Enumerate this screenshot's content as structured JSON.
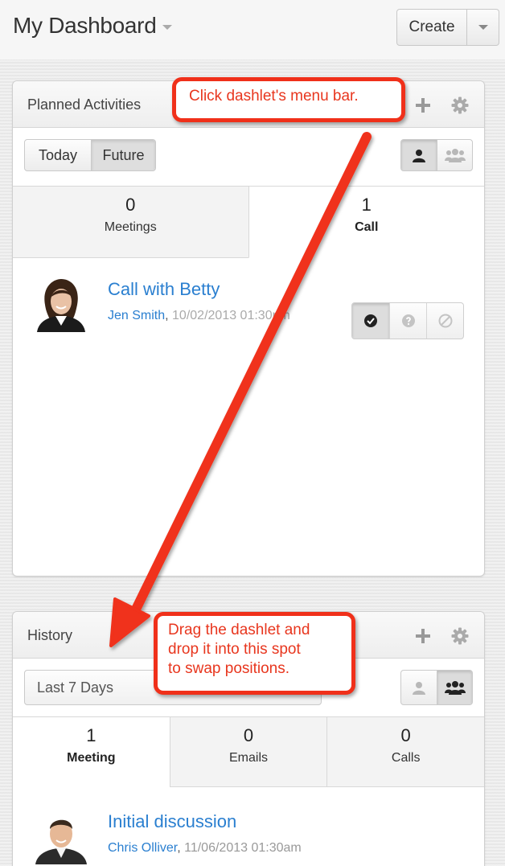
{
  "header": {
    "title": "My Dashboard",
    "create_label": "Create"
  },
  "planned": {
    "title": "Planned Activities",
    "range_tabs": [
      "Today",
      "Future"
    ],
    "active_range": "Future",
    "tabs": [
      {
        "count": "0",
        "label": "Meetings"
      },
      {
        "count": "1",
        "label": "Call"
      }
    ],
    "active_tab": "Call",
    "record": {
      "subject": "Call with Betty",
      "assigned": "Jen Smith",
      "date": "10/02/2013 01:30pm"
    }
  },
  "history": {
    "title": "History",
    "range_value": "Last 7 Days",
    "tabs": [
      {
        "count": "1",
        "label": "Meeting"
      },
      {
        "count": "0",
        "label": "Emails"
      },
      {
        "count": "0",
        "label": "Calls"
      }
    ],
    "active_tab": "Meeting",
    "record": {
      "subject": "Initial discussion",
      "assigned": "Chris Olliver",
      "date": "11/06/2013 01:30am"
    }
  },
  "annotations": {
    "callout_top": "Click dashlet's menu bar.",
    "callout_bottom": [
      "Drag the dashlet and",
      "drop it into this spot",
      "to swap positions."
    ]
  },
  "colors": {
    "link": "#2a7fd0",
    "callout_red": "#f0301a"
  },
  "icons": [
    "caret-down-icon",
    "plus-icon",
    "gear-icon",
    "user-icon",
    "group-icon",
    "check-icon",
    "question-icon",
    "cancel-icon"
  ]
}
